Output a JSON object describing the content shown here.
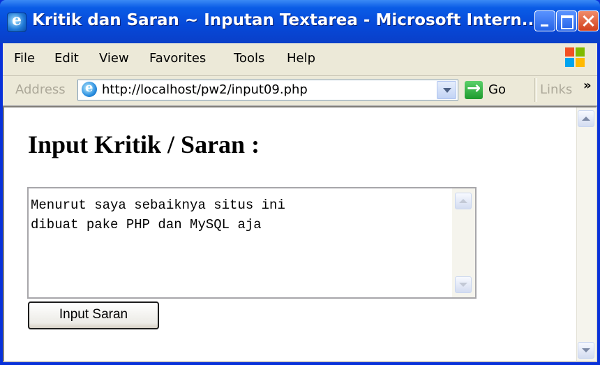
{
  "window": {
    "title": "Kritik dan Saran ~ Inputan Textarea - Microsoft Intern...",
    "minimize_label": "",
    "maximize_label": "",
    "close_label": ""
  },
  "menu": {
    "items": [
      "File",
      "Edit",
      "View",
      "Favorites",
      "Tools",
      "Help"
    ]
  },
  "address_bar": {
    "label": "Address",
    "url": "http://localhost/pw2/input09.php",
    "go_label": "Go",
    "links_label": "Links",
    "chevron": "»"
  },
  "page": {
    "heading": "Input Kritik / Saran :",
    "textarea_value": "Menurut saya sebaiknya situs ini\ndibuat pake PHP dan MySQL aja",
    "submit_label": "Input Saran"
  }
}
